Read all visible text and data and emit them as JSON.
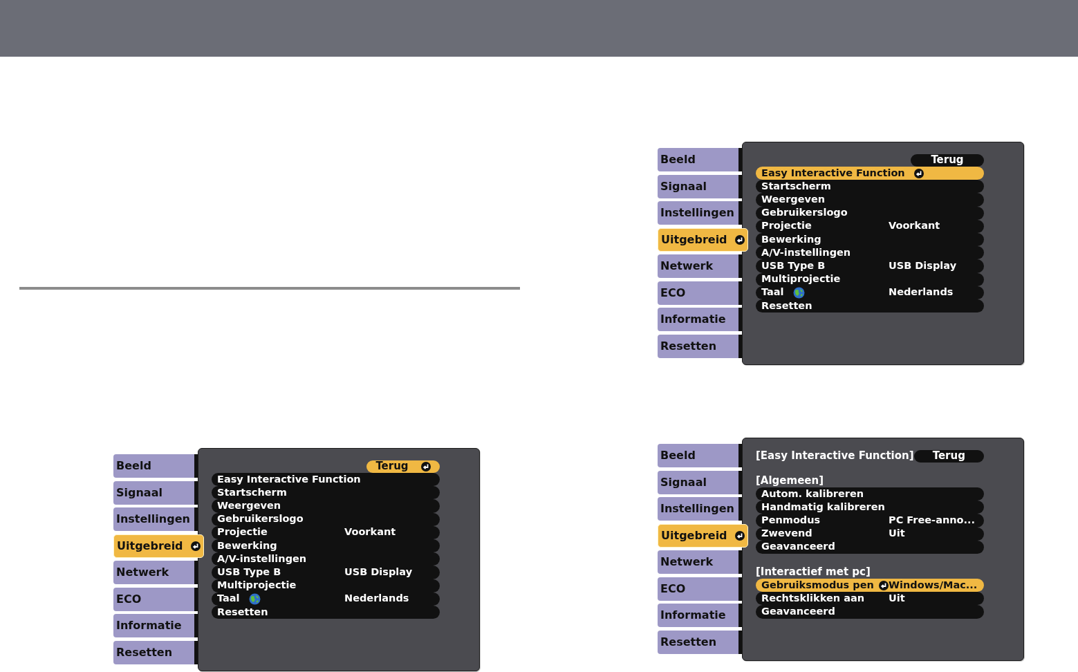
{
  "left_menu": {
    "tabs": [
      {
        "label": "Beeld",
        "selected": false
      },
      {
        "label": "Signaal",
        "selected": false
      },
      {
        "label": "Instellingen",
        "selected": false
      },
      {
        "label": "Uitgebreid",
        "selected": true
      },
      {
        "label": "Netwerk",
        "selected": false
      },
      {
        "label": "ECO",
        "selected": false
      },
      {
        "label": "Informatie",
        "selected": false
      },
      {
        "label": "Resetten",
        "selected": false
      }
    ],
    "back": {
      "label": "Terug",
      "selected": true
    },
    "rows": [
      {
        "kind": "item",
        "label": "Easy Interactive Function",
        "selected": false
      },
      {
        "kind": "item",
        "label": "Startscherm",
        "selected": false
      },
      {
        "kind": "item",
        "label": "Weergeven",
        "selected": false
      },
      {
        "kind": "item",
        "label": "Gebruikerslogo",
        "selected": false
      },
      {
        "kind": "item",
        "label": "Projectie",
        "value": "Voorkant",
        "selected": false
      },
      {
        "kind": "item",
        "label": "Bewerking",
        "selected": false
      },
      {
        "kind": "item",
        "label": "A/V-instellingen",
        "selected": false
      },
      {
        "kind": "item",
        "label": "USB Type B",
        "value": "USB Display",
        "selected": false
      },
      {
        "kind": "item",
        "label": "Multiprojectie",
        "selected": false
      },
      {
        "kind": "item",
        "label": "Taal",
        "globe": true,
        "value": "Nederlands",
        "selected": false
      },
      {
        "kind": "item",
        "label": "Resetten",
        "selected": false
      }
    ]
  },
  "right_menus": [
    {
      "tabs": [
        {
          "label": "Beeld",
          "selected": false
        },
        {
          "label": "Signaal",
          "selected": false
        },
        {
          "label": "Instellingen",
          "selected": false
        },
        {
          "label": "Uitgebreid",
          "selected": true
        },
        {
          "label": "Netwerk",
          "selected": false
        },
        {
          "label": "ECO",
          "selected": false
        },
        {
          "label": "Informatie",
          "selected": false
        },
        {
          "label": "Resetten",
          "selected": false
        }
      ],
      "back": {
        "label": "Terug",
        "selected": false
      },
      "rows": [
        {
          "kind": "item",
          "label": "Easy Interactive Function",
          "selected": true
        },
        {
          "kind": "item",
          "label": "Startscherm",
          "selected": false
        },
        {
          "kind": "item",
          "label": "Weergeven",
          "selected": false
        },
        {
          "kind": "item",
          "label": "Gebruikerslogo",
          "selected": false
        },
        {
          "kind": "item",
          "label": "Projectie",
          "value": "Voorkant",
          "selected": false
        },
        {
          "kind": "item",
          "label": "Bewerking",
          "selected": false
        },
        {
          "kind": "item",
          "label": "A/V-instellingen",
          "selected": false
        },
        {
          "kind": "item",
          "label": "USB Type B",
          "value": "USB Display",
          "selected": false
        },
        {
          "kind": "item",
          "label": "Multiprojectie",
          "selected": false
        },
        {
          "kind": "item",
          "label": "Taal",
          "globe": true,
          "value": "Nederlands",
          "selected": false
        },
        {
          "kind": "item",
          "label": "Resetten",
          "selected": false
        }
      ]
    },
    {
      "tabs": [
        {
          "label": "Beeld",
          "selected": false
        },
        {
          "label": "Signaal",
          "selected": false
        },
        {
          "label": "Instellingen",
          "selected": false
        },
        {
          "label": "Uitgebreid",
          "selected": true
        },
        {
          "label": "Netwerk",
          "selected": false
        },
        {
          "label": "ECO",
          "selected": false
        },
        {
          "label": "Informatie",
          "selected": false
        },
        {
          "label": "Resetten",
          "selected": false
        }
      ],
      "title": "[Easy Interactive Function]",
      "back": {
        "label": "Terug",
        "selected": false
      },
      "rows": [
        {
          "kind": "heading",
          "label": "[Algemeen]"
        },
        {
          "kind": "item",
          "label": "Autom. kalibreren",
          "selected": false
        },
        {
          "kind": "item",
          "label": "Handmatig kalibreren",
          "selected": false
        },
        {
          "kind": "item",
          "label": "Penmodus",
          "value": "PC Free-anno...",
          "selected": false
        },
        {
          "kind": "item",
          "label": "Zwevend",
          "value": "Uit",
          "selected": false
        },
        {
          "kind": "item",
          "label": "Geavanceerd",
          "selected": false
        },
        {
          "kind": "heading",
          "label": "[Interactief met pc]"
        },
        {
          "kind": "item",
          "label": "Gebruiksmodus pen",
          "value": "Windows/Mac...",
          "selected": true
        },
        {
          "kind": "item",
          "label": "Rechtsklikken aan",
          "value": "Uit",
          "selected": false
        },
        {
          "kind": "item",
          "label": "Geavanceerd",
          "selected": false
        }
      ]
    }
  ]
}
